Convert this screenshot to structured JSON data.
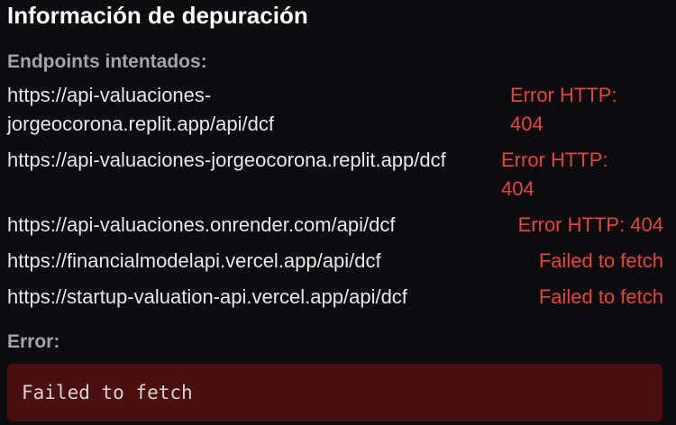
{
  "title": "Información de depuración",
  "endpoints_label": "Endpoints intentados:",
  "endpoints": [
    {
      "url": "https://api-valuaciones-jorgeocorona.replit.app/api/dcf",
      "status": "Error HTTP: 404"
    },
    {
      "url": "https://api-valuaciones-jorgeocorona.replit.app/dcf",
      "status": "Error HTTP: 404"
    },
    {
      "url": "https://api-valuaciones.onrender.com/api/dcf",
      "status": "Error HTTP: 404"
    },
    {
      "url": "https://financialmodelapi.vercel.app/api/dcf",
      "status": "Failed to fetch"
    },
    {
      "url": "https://startup-valuation-api.vercel.app/api/dcf",
      "status": "Failed to fetch"
    }
  ],
  "error_label": "Error:",
  "error_message": "Failed to fetch",
  "colors": {
    "background": "#0c0b0e",
    "error_text": "#e5453c",
    "error_box": "#4a0f0f"
  }
}
